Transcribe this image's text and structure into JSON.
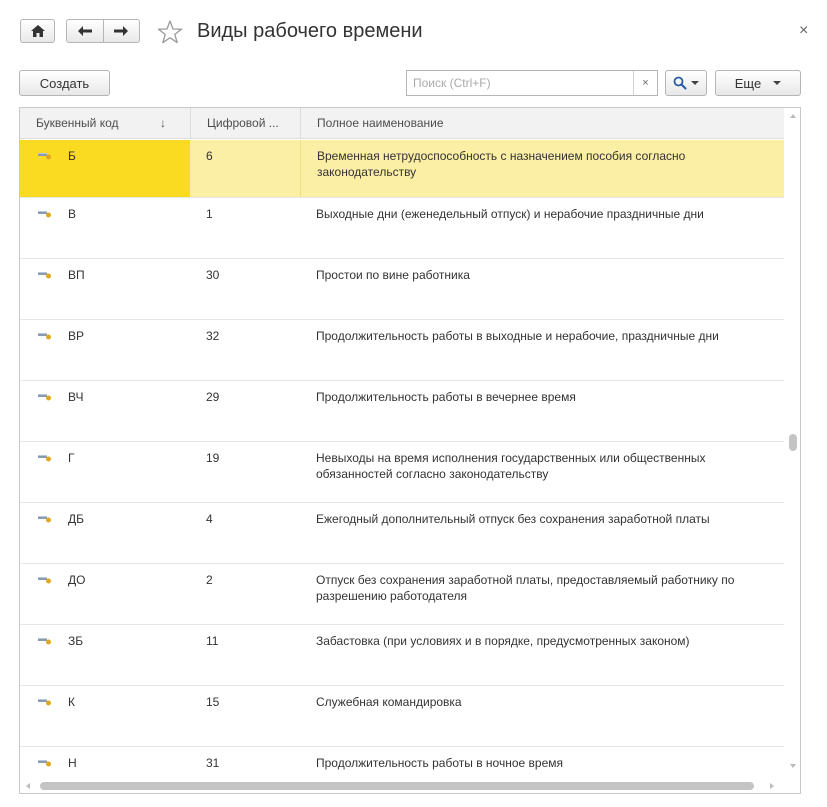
{
  "window": {
    "title": "Виды рабочего времени",
    "close_glyph": "×"
  },
  "toolbar": {
    "create_label": "Создать",
    "search_placeholder": "Поиск (Ctrl+F)",
    "search_clear_glyph": "×",
    "more_label": "Еще"
  },
  "icons": {
    "home": "home-icon",
    "back": "arrow-left-icon",
    "forward": "arrow-right-icon",
    "favorite": "star-icon",
    "search": "magnifier-icon",
    "row": "record-icon"
  },
  "table": {
    "headers": {
      "code": "Буквенный код",
      "number": "Цифровой ...",
      "name": "Полное наименование"
    },
    "sort_indicator": "↓",
    "selected_row_index": 0,
    "rows": [
      {
        "code": "Б",
        "number": "6",
        "name": "Временная нетрудоспособность с назначением пособия согласно законодательству"
      },
      {
        "code": "В",
        "number": "1",
        "name": "Выходные дни (еженедельный отпуск) и  нерабочие праздничные дни"
      },
      {
        "code": "ВП",
        "number": "30",
        "name": "Простои по вине работника"
      },
      {
        "code": "ВР",
        "number": "32",
        "name": "Продолжительность работы в выходные и нерабочие, праздничные дни"
      },
      {
        "code": "ВЧ",
        "number": "29",
        "name": "Продолжительность работы в вечернее время"
      },
      {
        "code": "Г",
        "number": "19",
        "name": "Невыходы на время исполнения государственных или общественных обязанностей согласно законодательству"
      },
      {
        "code": "ДБ",
        "number": "4",
        "name": "Ежегодный дополнительный отпуск без сохранения заработной платы"
      },
      {
        "code": "ДО",
        "number": "2",
        "name": "Отпуск без сохранения заработной платы, предоставляемый работнику по разрешению работодателя"
      },
      {
        "code": "ЗБ",
        "number": "11",
        "name": "Забастовка (при условиях и в порядке, предусмотренных законом)"
      },
      {
        "code": "К",
        "number": "15",
        "name": "Служебная командировка"
      },
      {
        "code": "Н",
        "number": "31",
        "name": "Продолжительность работы в ночное время"
      }
    ]
  },
  "colors": {
    "selected_row": "#fbeea5",
    "selected_cell": "#fadb21"
  }
}
